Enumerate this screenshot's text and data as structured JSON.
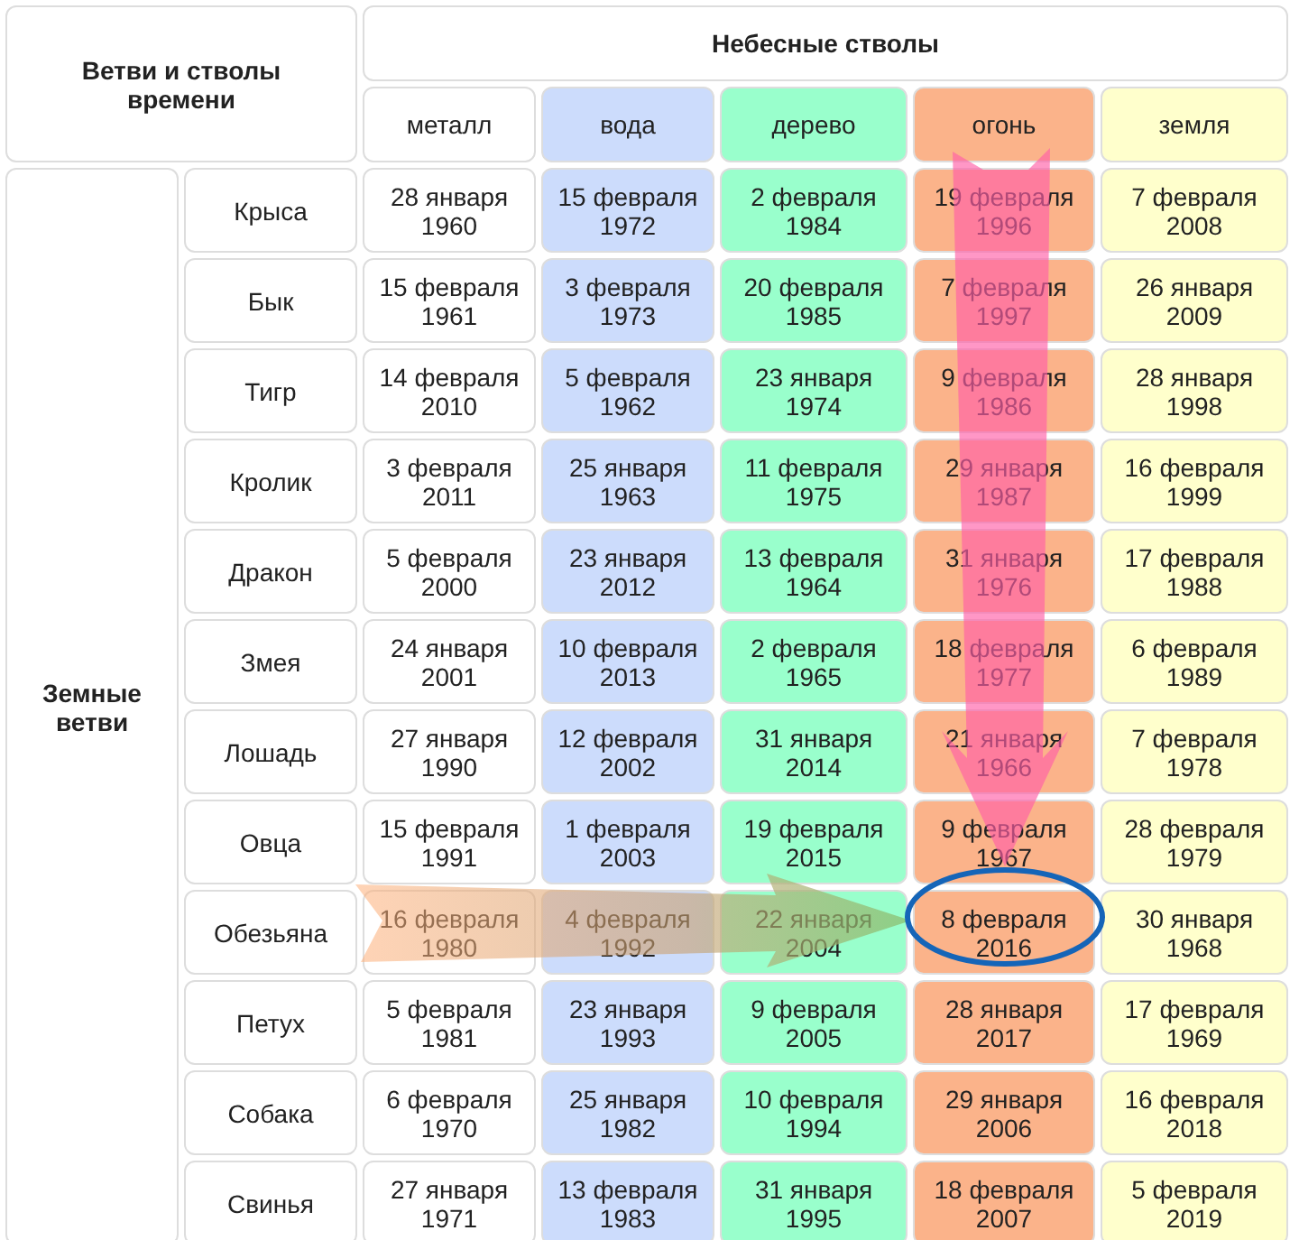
{
  "corner_title": "Ветви и стволы времени",
  "stems_title": "Небесные стволы",
  "branches_title": "Земные ветви",
  "elements": [
    {
      "name": "металл",
      "color": "#ffffff"
    },
    {
      "name": "вода",
      "color": "#ccdcfc"
    },
    {
      "name": "дерево",
      "color": "#99ffcc"
    },
    {
      "name": "огонь",
      "color": "#fbb38a"
    },
    {
      "name": "земля",
      "color": "#ffffcc"
    }
  ],
  "rows": [
    {
      "animal": "Крыса",
      "cells": [
        "28 января 1960",
        "15 февраля 1972",
        "2 февраля 1984",
        "19 февраля 1996",
        "7 февраля 2008"
      ]
    },
    {
      "animal": "Бык",
      "cells": [
        "15 февраля 1961",
        "3 февраля 1973",
        "20 февраля 1985",
        "7 февраля 1997",
        "26 января 2009"
      ]
    },
    {
      "animal": "Тигр",
      "cells": [
        "14 февраля 2010",
        "5 февраля 1962",
        "23 января 1974",
        "9 февраля 1986",
        "28 января 1998"
      ]
    },
    {
      "animal": "Кролик",
      "cells": [
        "3 февраля 2011",
        "25 января 1963",
        "11 февраля 1975",
        "29 января 1987",
        "16 февраля 1999"
      ]
    },
    {
      "animal": "Дракон",
      "cells": [
        "5 февраля 2000",
        "23 января 2012",
        "13 февраля 1964",
        "31 января 1976",
        "17 февраля 1988"
      ]
    },
    {
      "animal": "Змея",
      "cells": [
        "24 января 2001",
        "10 февраля 2013",
        "2 февраля 1965",
        "18 февраля 1977",
        "6 февраля 1989"
      ]
    },
    {
      "animal": "Лошадь",
      "cells": [
        "27 января 1990",
        "12 февраля 2002",
        "31 января 2014",
        "21 января 1966",
        "7 февраля 1978"
      ]
    },
    {
      "animal": "Овца",
      "cells": [
        "15 февраля 1991",
        "1 февраля 2003",
        "19 февраля 2015",
        "9 февраля 1967",
        "28 февраля 1979"
      ]
    },
    {
      "animal": "Обезьяна",
      "cells": [
        "16 февраля 1980",
        "4 февраля 1992",
        "22 января 2004",
        "8 февраля 2016",
        "30 января 1968"
      ]
    },
    {
      "animal": "Петух",
      "cells": [
        "5 февраля 1981",
        "23 января 1993",
        "9 февраля 2005",
        "28 января 2017",
        "17 февраля 1969"
      ]
    },
    {
      "animal": "Собака",
      "cells": [
        "6 февраля 1970",
        "25 января 1982",
        "10 февраля 1994",
        "29 января 2006",
        "16 февраля 2018"
      ]
    },
    {
      "animal": "Свинья",
      "cells": [
        "27 января 1971",
        "13 февраля 1983",
        "31 января 1995",
        "18 февраля 2007",
        "5 февраля 2019"
      ]
    }
  ]
}
